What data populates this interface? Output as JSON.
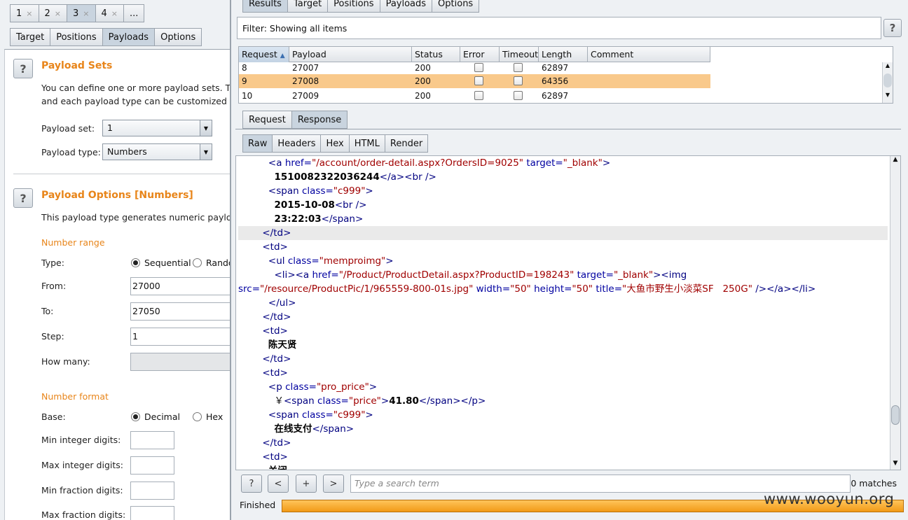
{
  "left": {
    "attack_tabs": [
      {
        "label": "1",
        "close": "×",
        "active": false
      },
      {
        "label": "2",
        "close": "×",
        "active": false
      },
      {
        "label": "3",
        "close": "×",
        "active": true
      },
      {
        "label": "4",
        "close": "×",
        "active": false
      },
      {
        "label": "...",
        "close": "",
        "active": false
      }
    ],
    "sub_tabs": [
      {
        "label": "Target",
        "active": false
      },
      {
        "label": "Positions",
        "active": false
      },
      {
        "label": "Payloads",
        "active": true
      },
      {
        "label": "Options",
        "active": false
      }
    ],
    "help_glyph": "?",
    "payload_sets": {
      "title": "Payload Sets",
      "desc_line1": "You can define one or more payload sets. The",
      "desc_line2": "and each payload type can be customized in d",
      "set_label": "Payload set:",
      "set_value": "1",
      "type_label": "Payload type:",
      "type_value": "Numbers"
    },
    "payload_options": {
      "title": "Payload Options [Numbers]",
      "desc": "This payload type generates numeric payloads",
      "number_range": "Number range",
      "type_label": "Type:",
      "sequential": "Sequential",
      "random": "Rando",
      "from_label": "From:",
      "from_value": "27000",
      "to_label": "To:",
      "to_value": "27050",
      "step_label": "Step:",
      "step_value": "1",
      "howmany_label": "How many:",
      "number_format": "Number format",
      "base_label": "Base:",
      "decimal": "Decimal",
      "hex": "Hex",
      "min_int": "Min integer digits:",
      "max_int": "Max integer digits:",
      "min_frac": "Min fraction digits:",
      "max_frac": "Max fraction digits:"
    }
  },
  "right": {
    "tabs": [
      {
        "label": "Results",
        "active": true
      },
      {
        "label": "Target",
        "active": false
      },
      {
        "label": "Positions",
        "active": false
      },
      {
        "label": "Payloads",
        "active": false
      },
      {
        "label": "Options",
        "active": false
      }
    ],
    "filter": "Filter: Showing all items",
    "help_glyph": "?",
    "table": {
      "columns": [
        "Request",
        "Payload",
        "Status",
        "Error",
        "Timeout",
        "Length",
        "Comment"
      ],
      "sort_indicator": "▲",
      "rows": [
        {
          "request": "8",
          "payload": "27007",
          "status": "200",
          "length": "62897",
          "selected": false
        },
        {
          "request": "9",
          "payload": "27008",
          "status": "200",
          "length": "64356",
          "selected": true
        },
        {
          "request": "10",
          "payload": "27009",
          "status": "200",
          "length": "62897",
          "selected": false
        }
      ]
    },
    "reqresp_tabs": [
      {
        "label": "Request",
        "active": false
      },
      {
        "label": "Response",
        "active": true
      }
    ],
    "view_tabs": [
      {
        "label": "Raw",
        "active": true
      },
      {
        "label": "Headers",
        "active": false
      },
      {
        "label": "Hex",
        "active": false
      },
      {
        "label": "HTML",
        "active": false
      },
      {
        "label": "Render",
        "active": false
      }
    ],
    "code": {
      "href1": "\"/account/order-detail.aspx?OrdersID=9025\"",
      "target_val": "\"_blank\"",
      "order_no": "1510082322036244",
      "c999": "\"c999\"",
      "date": "2015-10-08",
      "time": "23:22:03",
      "memproimg": "\"memproimg\"",
      "href2": "\"/Product/ProductDetail.aspx?ProductID=198243\"",
      "src_val": "\"/resource/ProductPic/1/965559-800-01s.jpg\"",
      "w_val": "\"50\"",
      "h_val": "\"50\"",
      "title_val": "\"大鱼市野生小淡菜SF   250G\"",
      "name": "陈天贤",
      "pro_price": "\"pro_price\"",
      "yen": "￥",
      "price_cls": "\"price\"",
      "price": "41.80",
      "pay": "在线支付",
      "partial": "关闭"
    },
    "nav": {
      "help": "?",
      "prev": "<",
      "add": "+",
      "next": ">"
    },
    "search_placeholder": "Type a search term",
    "matches": "0 matches",
    "status": "Finished",
    "progress": 1.0,
    "watermark": "www.wooyun.org"
  }
}
